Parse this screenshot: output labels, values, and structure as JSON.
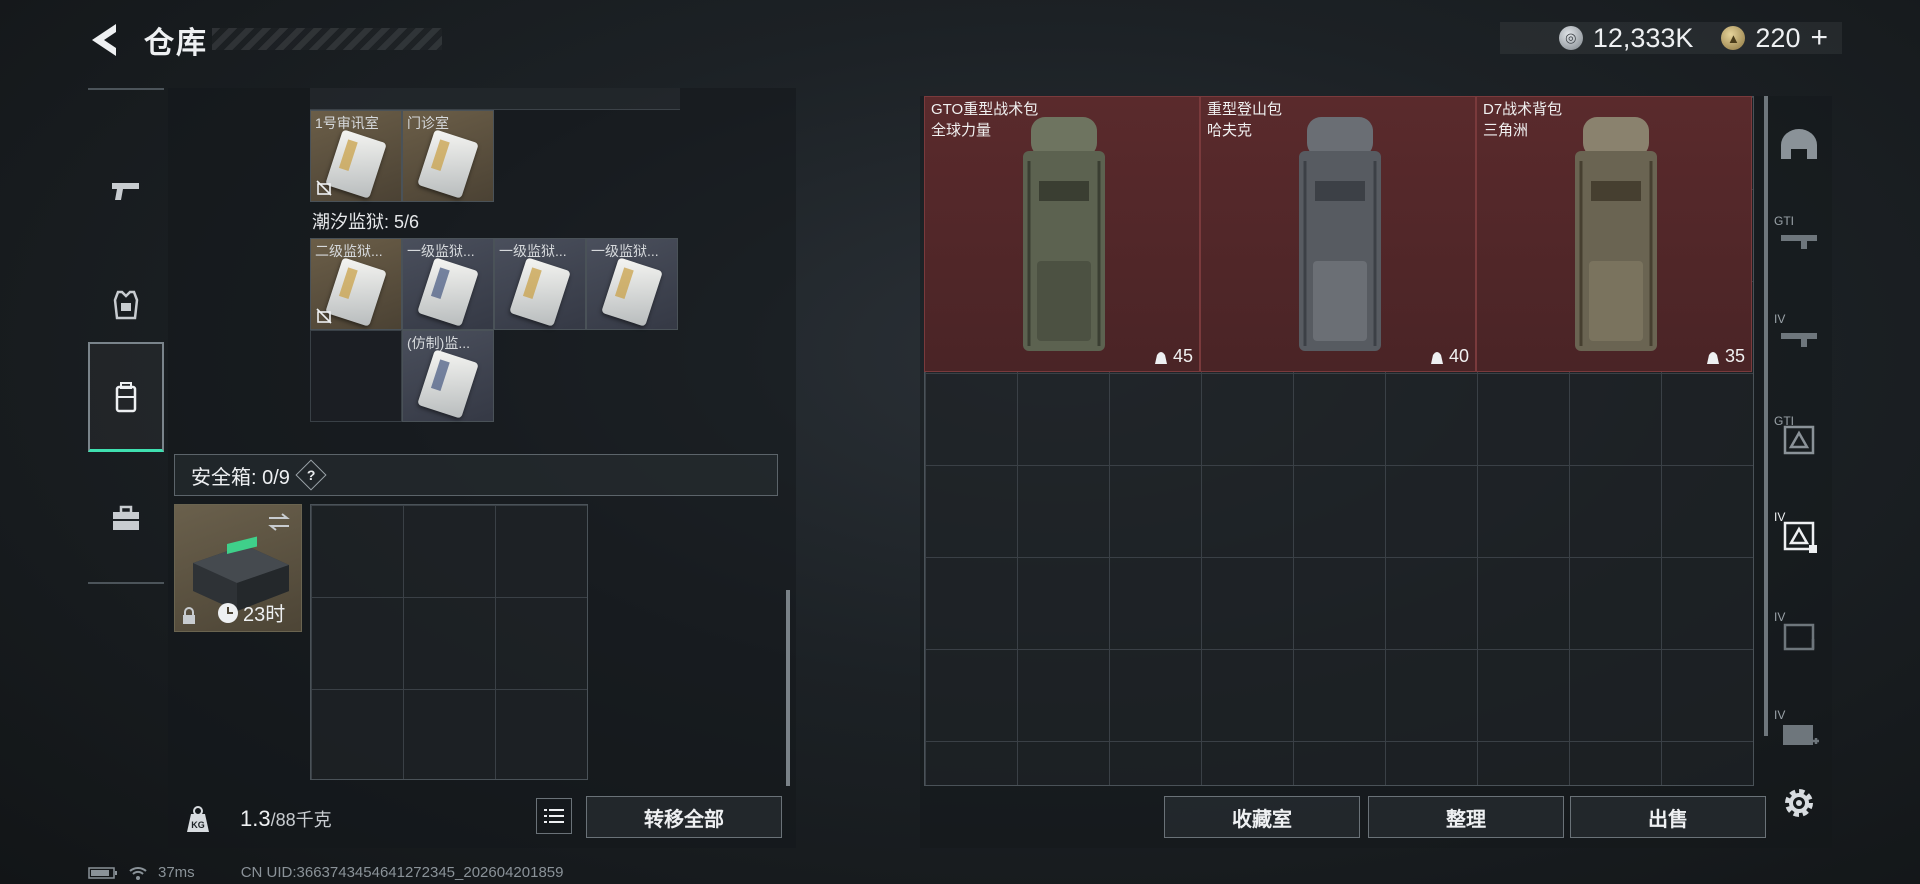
{
  "header": {
    "title": "仓库",
    "currency": [
      {
        "icon": "silver-coin-icon",
        "value": "12,333K"
      },
      {
        "icon": "gold-coin-icon",
        "value": "220"
      }
    ],
    "plus_label": "+"
  },
  "left_nav": [
    {
      "icon": "pistol-icon"
    },
    {
      "icon": "armor-vest-icon"
    },
    {
      "icon": "backpack-icon",
      "active": true
    },
    {
      "icon": "toolbox-icon"
    }
  ],
  "keycards_top": [
    {
      "label": "1号审讯室",
      "tone": "tan",
      "no_link": true
    },
    {
      "label": "门诊室",
      "tone": "tan",
      "no_link": false
    }
  ],
  "prison_section": {
    "label": "潮汐监狱: 5/6",
    "cards": [
      {
        "label": "二级监狱...",
        "tone": "tan",
        "no_link": true
      },
      {
        "label": "一级监狱...",
        "tone": "gray"
      },
      {
        "label": "一级监狱...",
        "tone": "gray"
      },
      {
        "label": "一级监狱...",
        "tone": "gray"
      },
      {
        "label": "(仿制)监...",
        "tone": "gray"
      }
    ]
  },
  "safe": {
    "label": "安全箱: 0/9",
    "help": "?",
    "timer": "23时"
  },
  "weight": {
    "current": "1.3",
    "max": "/88千克"
  },
  "buttons": {
    "transfer_all": "转移全部",
    "collection": "收藏室",
    "sort": "整理",
    "sell": "出售"
  },
  "bags": [
    {
      "name": "GTO重型战术包",
      "brand": "全球力量",
      "capacity": "45",
      "color": "#6e7460"
    },
    {
      "name": "重型登山包",
      "brand": "哈夫克",
      "capacity": "40",
      "color": "#6a6e74"
    },
    {
      "name": "D7战术背包",
      "brand": "三角洲",
      "capacity": "35",
      "color": "#7a7260"
    }
  ],
  "right_sidebar": [
    {
      "icon": "helmet-icon",
      "tag": ""
    },
    {
      "icon": "rifle-gti-icon",
      "tag": "GTI"
    },
    {
      "icon": "rifle-iv-icon",
      "tag": "IV"
    },
    {
      "icon": "vest-gti-icon",
      "tag": "GTI"
    },
    {
      "icon": "vest-iv-icon",
      "tag": "IV",
      "active": true
    },
    {
      "icon": "bag-iv-icon",
      "tag": "IV"
    },
    {
      "icon": "medkit-iv-icon",
      "tag": "IV"
    },
    {
      "icon": "gear-icon",
      "tag": ""
    }
  ],
  "status": {
    "ping": "37ms",
    "uid": "CN UID:3663743454641272345_202604201859"
  }
}
